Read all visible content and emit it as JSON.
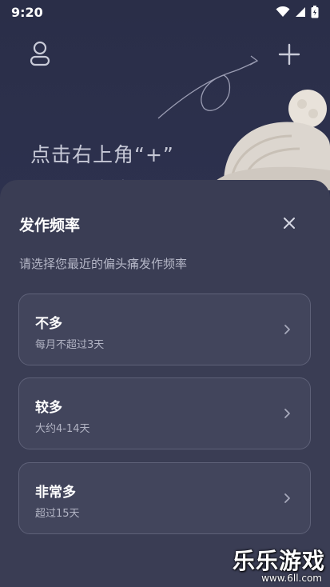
{
  "status_bar": {
    "time": "9:20"
  },
  "background": {
    "hint_line1": "点击右上角“+”",
    "hint_line2": "记录上次发作"
  },
  "sheet": {
    "title": "发作频率",
    "subtitle": "请选择您最近的偏头痛发作频率",
    "options": [
      {
        "title": "不多",
        "desc": "每月不超过3天"
      },
      {
        "title": "较多",
        "desc": "大约4-14天"
      },
      {
        "title": "非常多",
        "desc": "超过15天"
      }
    ]
  },
  "watermark": {
    "brand": "乐乐游戏",
    "url": "www.6ll.com"
  },
  "colors": {
    "background": "#2b2f45",
    "sheet": "#3a3d54",
    "card": "#42455c",
    "card_border": "#5e6178"
  }
}
